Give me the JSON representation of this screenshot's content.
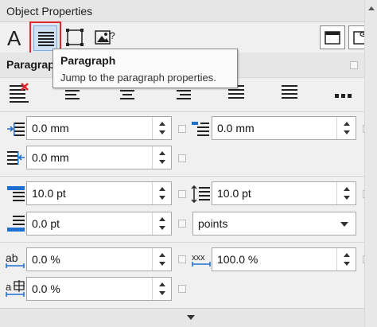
{
  "title": "Object Properties",
  "section_title": "Paragraph",
  "tooltip": {
    "heading": "Paragraph",
    "description": "Jump to the paragraph properties."
  },
  "toolbar": {
    "character_glyph": "A"
  },
  "fields": {
    "left_indent": "0.0 mm",
    "first_line_indent": "0.0 mm",
    "right_indent": "0.0 mm",
    "before_paragraph": "10.0 pt",
    "line_spacing": "10.0 pt",
    "after_paragraph": "0.0 pt",
    "spacing_units": "points",
    "character_spacing": "0.0 %",
    "word_spacing": "100.0 %",
    "language_spacing": "0.0 %"
  },
  "icons": {
    "character": "character-icon",
    "paragraph": "paragraph-icon",
    "frame": "frame-icon",
    "image_frame": "image-frame-icon",
    "panel_left": "panel-icon",
    "panel_preview": "panel-preview-icon"
  }
}
